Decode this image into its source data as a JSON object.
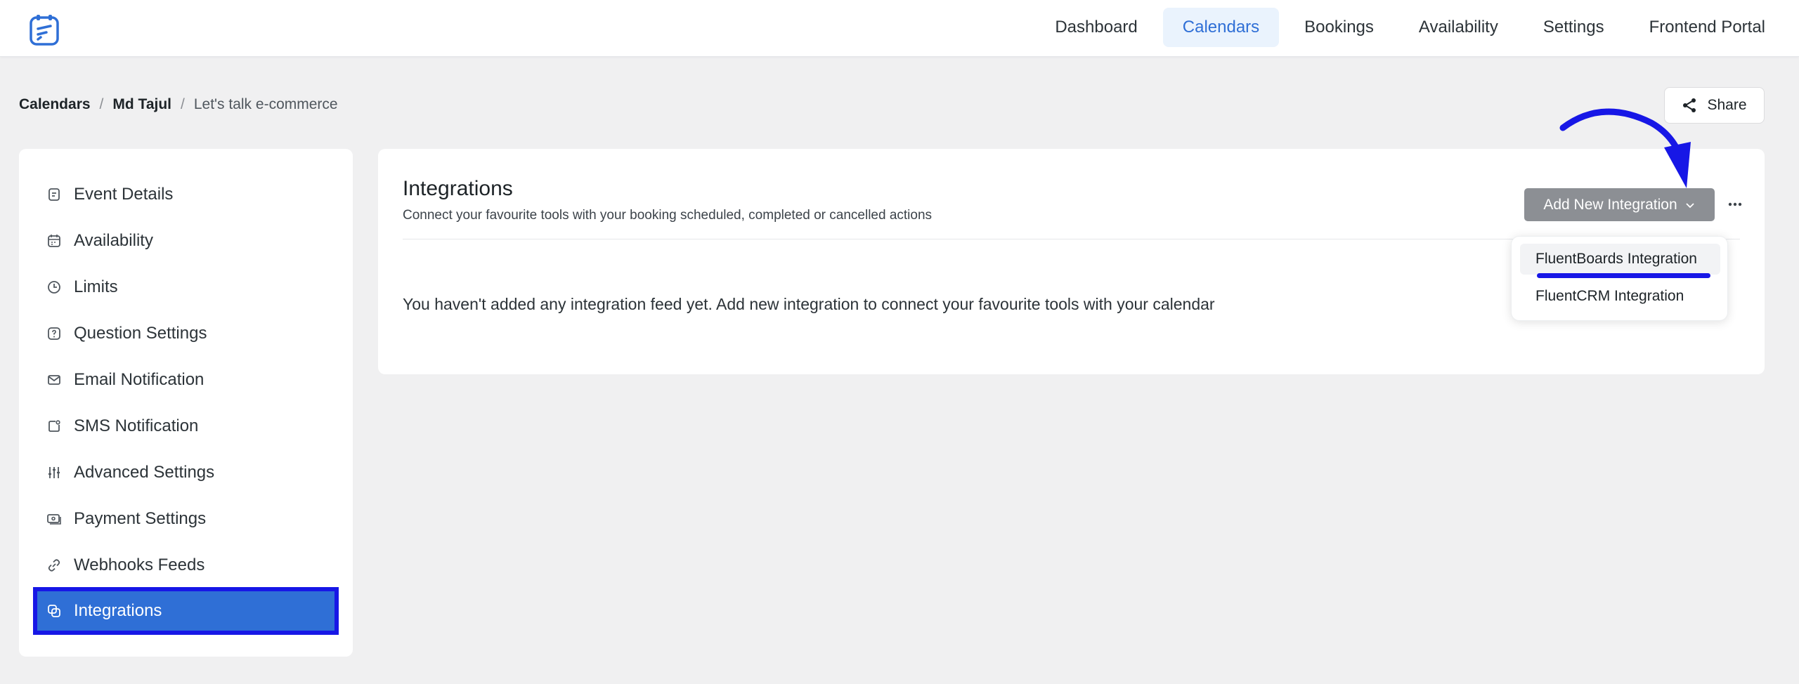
{
  "nav": {
    "items": [
      {
        "label": "Dashboard",
        "active": false
      },
      {
        "label": "Calendars",
        "active": true
      },
      {
        "label": "Bookings",
        "active": false
      },
      {
        "label": "Availability",
        "active": false
      },
      {
        "label": "Settings",
        "active": false
      },
      {
        "label": "Frontend Portal",
        "active": false
      }
    ]
  },
  "breadcrumb": {
    "items": [
      "Calendars",
      "Md Tajul",
      "Let's talk e-commerce"
    ],
    "separator": "/"
  },
  "share": {
    "label": "Share",
    "icon": "share-icon"
  },
  "sidebar": {
    "items": [
      {
        "label": "Event Details",
        "icon": "event-details-icon"
      },
      {
        "label": "Availability",
        "icon": "calendar-icon"
      },
      {
        "label": "Limits",
        "icon": "clock-icon"
      },
      {
        "label": "Question Settings",
        "icon": "question-icon"
      },
      {
        "label": "Email Notification",
        "icon": "mail-icon"
      },
      {
        "label": "SMS Notification",
        "icon": "sms-icon"
      },
      {
        "label": "Advanced Settings",
        "icon": "sliders-icon"
      },
      {
        "label": "Payment Settings",
        "icon": "payment-icon"
      },
      {
        "label": "Webhooks Feeds",
        "icon": "link-icon"
      },
      {
        "label": "Integrations",
        "icon": "integrations-icon",
        "active": true
      }
    ]
  },
  "main": {
    "title": "Integrations",
    "subtitle": "Connect your favourite tools with your booking scheduled, completed or cancelled actions",
    "empty_message": "You haven't added any integration feed yet. Add new integration to connect your favourite tools with your calendar",
    "add_button": "Add New Integration",
    "dropdown": [
      "FluentBoards Integration",
      "FluentCRM Integration"
    ]
  },
  "colors": {
    "accent": "#2f6fd6",
    "annotation": "#1717e6",
    "disabled_button": "#8c8f94",
    "background": "#f0f0f1"
  }
}
